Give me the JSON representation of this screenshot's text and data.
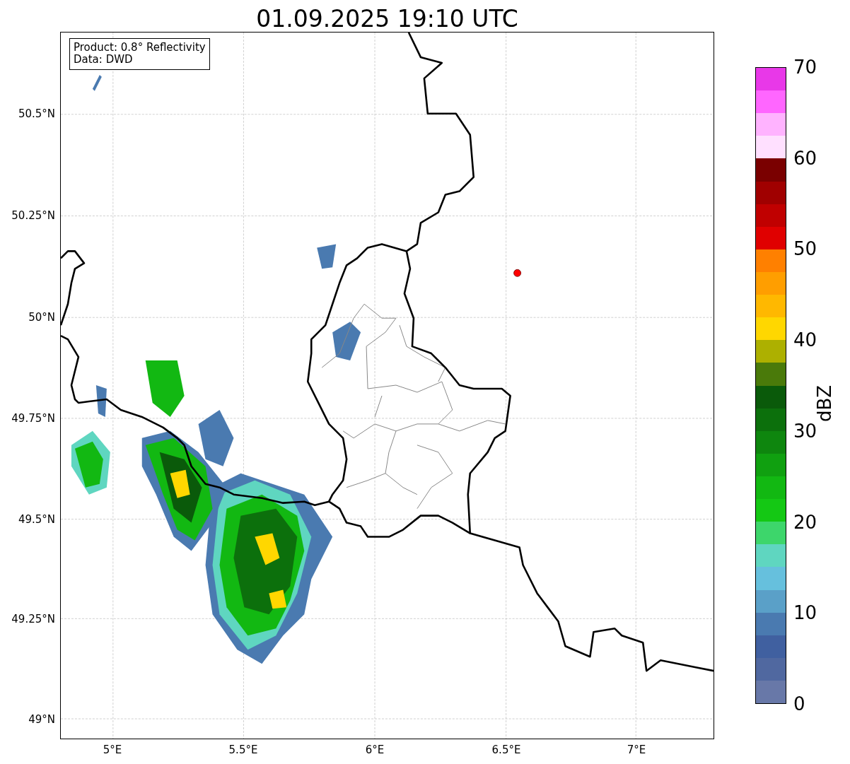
{
  "title": "01.09.2025 19:10 UTC",
  "info_box": {
    "lines": [
      "Product: 0.8° Reflectivity",
      "Data: DWD"
    ]
  },
  "axes": {
    "yticks": [
      "50.5°N",
      "50.25°N",
      "50°N",
      "49.75°N",
      "49.5°N",
      "49.25°N",
      "49°N"
    ],
    "xticks": [
      "5°E",
      "5.5°E",
      "6°E",
      "6.5°E",
      "7°E"
    ]
  },
  "colorbar": {
    "label": "dBZ",
    "ticks": [
      "70",
      "60",
      "50",
      "40",
      "30",
      "20",
      "10",
      "0"
    ],
    "bins": [
      {
        "color": "#e838e8"
      },
      {
        "color": "#ff66ff"
      },
      {
        "color": "#ffb3ff"
      },
      {
        "color": "#ffe0ff"
      },
      {
        "color": "#7a0000"
      },
      {
        "color": "#a00000"
      },
      {
        "color": "#c00000"
      },
      {
        "color": "#e00000"
      },
      {
        "color": "#ff8000"
      },
      {
        "color": "#ff9e00"
      },
      {
        "color": "#ffb800"
      },
      {
        "color": "#ffd700"
      },
      {
        "color": "#adb000"
      },
      {
        "color": "#4a7a0a"
      },
      {
        "color": "#0a5a0a"
      },
      {
        "color": "#0c700c"
      },
      {
        "color": "#0e860e"
      },
      {
        "color": "#10a010"
      },
      {
        "color": "#12b812"
      },
      {
        "color": "#14c814"
      },
      {
        "color": "#3dd66b"
      },
      {
        "color": "#5fd6c0"
      },
      {
        "color": "#66c0dd"
      },
      {
        "color": "#5aa0c8"
      },
      {
        "color": "#4a7ab0"
      },
      {
        "color": "#4060a0"
      },
      {
        "color": "#5068a0"
      },
      {
        "color": "#6878a8"
      }
    ]
  }
}
